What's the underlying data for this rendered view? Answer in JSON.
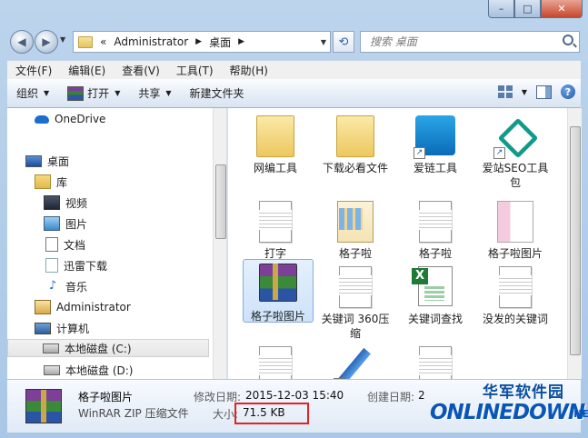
{
  "window": {
    "controls": {
      "minimize": "–",
      "maximize": "□",
      "close": "✕"
    }
  },
  "address": {
    "crumbs": [
      "«",
      "Administrator",
      "桌面"
    ],
    "search_placeholder": "搜索 桌面"
  },
  "menu": [
    "文件(F)",
    "编辑(E)",
    "查看(V)",
    "工具(T)",
    "帮助(H)"
  ],
  "toolbar": {
    "organize": "组织",
    "open": "打开",
    "share": "共享",
    "new_folder": "新建文件夹"
  },
  "nav": [
    {
      "label": "OneDrive",
      "icon": "onedrive-icon"
    },
    {
      "label": "桌面",
      "icon": "desktop-icon"
    },
    {
      "label": "库",
      "icon": "library-icon"
    },
    {
      "label": "视频",
      "icon": "video-icon"
    },
    {
      "label": "图片",
      "icon": "pictures-icon"
    },
    {
      "label": "文档",
      "icon": "documents-icon"
    },
    {
      "label": "迅雷下载",
      "icon": "thunder-download-icon"
    },
    {
      "label": "音乐",
      "icon": "music-icon"
    },
    {
      "label": "Administrator",
      "icon": "user-folder-icon"
    },
    {
      "label": "计算机",
      "icon": "computer-icon"
    },
    {
      "label": "本地磁盘 (C:)",
      "icon": "disk-icon",
      "selected": true
    },
    {
      "label": "本地磁盘 (D:)",
      "icon": "disk-icon"
    }
  ],
  "files": [
    {
      "name": "网编工具",
      "icon": "folder-icon"
    },
    {
      "name": "下载必看文件",
      "icon": "folder-icon"
    },
    {
      "name": "爱链工具",
      "icon": "app-shortcut-icon"
    },
    {
      "name": "爱站SEO工具包",
      "icon": "app-shortcut-icon"
    },
    {
      "name": "打字",
      "icon": "document-icon"
    },
    {
      "name": "格子啦",
      "icon": "image-folder-icon"
    },
    {
      "name": "格子啦",
      "icon": "document-icon"
    },
    {
      "name": "格子啦图片",
      "icon": "image-file-icon"
    },
    {
      "name": "格子啦图片",
      "icon": "winrar-archive-icon",
      "selected": true
    },
    {
      "name": "关键词 360压缩",
      "icon": "document-icon"
    },
    {
      "name": "关键词查找",
      "icon": "excel-icon"
    },
    {
      "name": "没发的关键词",
      "icon": "document-icon"
    }
  ],
  "details": {
    "name": "格子啦图片",
    "type": "WinRAR ZIP 压缩文件",
    "modified_label": "修改日期:",
    "modified_value": "2015-12-03 15:40",
    "created_label": "创建日期:",
    "created_value": "2",
    "size_label": "大小:",
    "size_value": "71.5 KB"
  },
  "watermark": {
    "top": "华军软件园",
    "bottom": "ONLINEDOWN",
    "suffix": ".NET"
  },
  "colors": {
    "highlight_border": "#e02424",
    "brand_blue": "#0a56b8"
  }
}
